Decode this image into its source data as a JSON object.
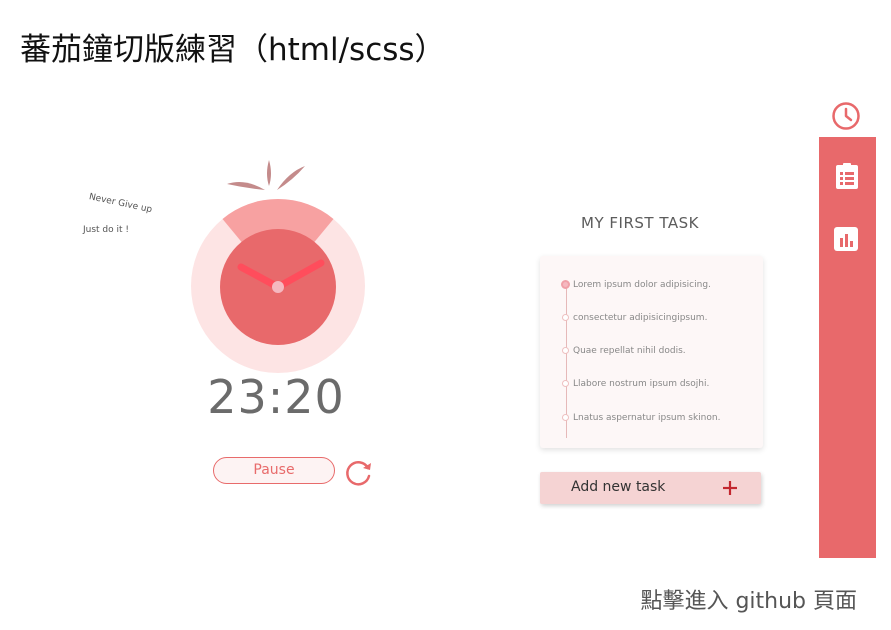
{
  "page": {
    "title": "蕃茄鐘切版練習（html/scss）",
    "footer_link": "點擊進入 github 頁面"
  },
  "mottos": [
    "Never Give up",
    "Just do it !"
  ],
  "timer": {
    "time": "23:20",
    "pause_label": "Pause",
    "progress_fraction": 0.22
  },
  "tasks": {
    "title": "MY FIRST TASK",
    "items": [
      {
        "label": "Lorem ipsum dolor adipisicing.",
        "active": true
      },
      {
        "label": "consectetur adipisicingipsum.",
        "active": false
      },
      {
        "label": "Quae repellat nihil dodis.",
        "active": false
      },
      {
        "label": "Llabore nostrum ipsum dsojhi.",
        "active": false
      },
      {
        "label": "Lnatus aspernatur ipsum skinon.",
        "active": false
      }
    ],
    "add_label": "Add new task"
  },
  "sidebar": {
    "icons": [
      "clock-icon",
      "list-icon",
      "chart-icon"
    ]
  },
  "colors": {
    "accent": "#e8696b",
    "tomato_inner": "#e8696b",
    "ring_light": "#fde4e4",
    "ring_progress": "#f7a1a1",
    "leaf": "#c48b8b",
    "hand": "#ff4d5c",
    "add_bg": "#f5d3d3",
    "plus": "#c3272f"
  }
}
